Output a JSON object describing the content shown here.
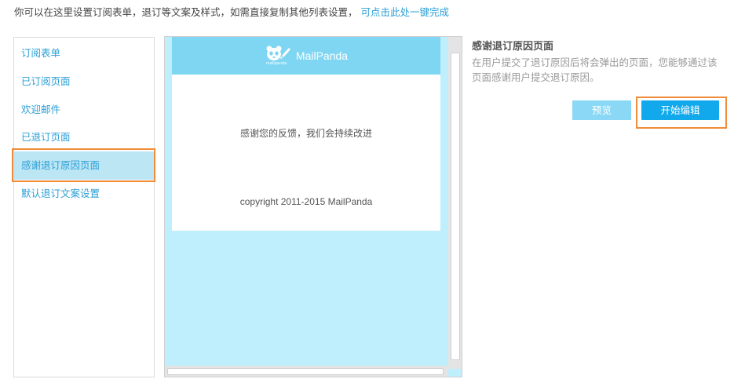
{
  "intro": {
    "text": "你可以在这里设置订阅表单，退订等文案及样式，如需直接复制其他列表设置，",
    "link": "可点击此处一键完成"
  },
  "sidebar": {
    "items": [
      {
        "label": "订阅表单"
      },
      {
        "label": "已订阅页面"
      },
      {
        "label": "欢迎邮件"
      },
      {
        "label": "已退订页面"
      },
      {
        "label": "感谢退订原因页面",
        "active": true
      },
      {
        "label": "默认退订文案设置"
      }
    ]
  },
  "preview": {
    "logo_name": "MailPanda",
    "logo_sub": "mailpanda",
    "message": "感谢您的反馈，我们会持续改进",
    "copyright": "copyright 2011-2015 MailPanda"
  },
  "panel": {
    "title": "感谢退订原因页面",
    "description": "在用户提交了退订原因后将会弹出的页面，您能够通过该页面感谢用户提交退订原因。",
    "preview_button": "预览",
    "edit_button": "开始编辑"
  },
  "colors": {
    "accent": "#2a9fd6",
    "highlight_outline": "#f08c3a",
    "preview_bg": "#bfeefc",
    "header_bg": "#7fd6f2",
    "primary_button": "#12a9ec",
    "secondary_button": "#8ad8f5"
  }
}
